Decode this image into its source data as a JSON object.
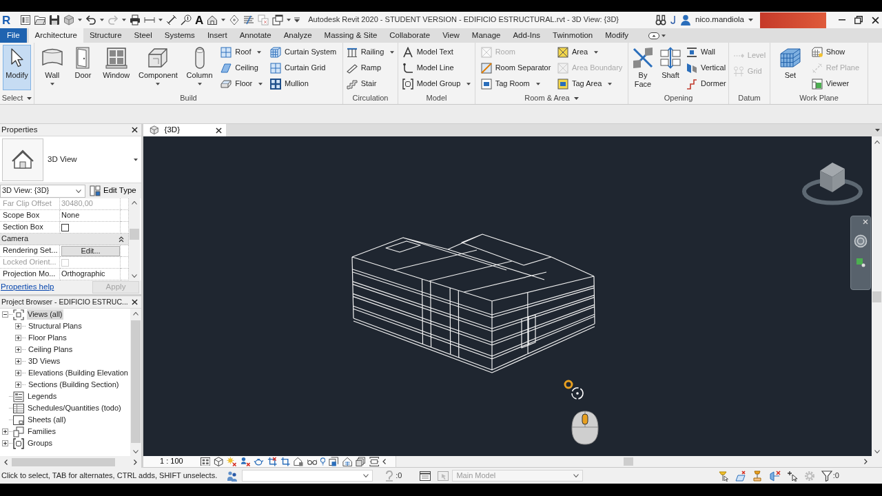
{
  "window": {
    "logo": "R",
    "title": "Autodesk Revit 2020 - STUDENT VERSION - EDIFICIO ESTRUCTURAL.rvt - 3D View: {3D}",
    "user": "nico.mandiola"
  },
  "quick_access": {
    "text_tool": "A"
  },
  "ribbon": {
    "tabs": [
      {
        "kind": "file",
        "label": "File",
        "selected": false
      },
      {
        "kind": "tab",
        "label": "Architecture",
        "selected": true
      },
      {
        "kind": "tab",
        "label": "Structure",
        "selected": false
      },
      {
        "kind": "tab",
        "label": "Steel",
        "selected": false
      },
      {
        "kind": "tab",
        "label": "Systems",
        "selected": false
      },
      {
        "kind": "tab",
        "label": "Insert",
        "selected": false
      },
      {
        "kind": "tab",
        "label": "Annotate",
        "selected": false
      },
      {
        "kind": "tab",
        "label": "Analyze",
        "selected": false
      },
      {
        "kind": "tab",
        "label": "Massing & Site",
        "selected": false
      },
      {
        "kind": "tab",
        "label": "Collaborate",
        "selected": false
      },
      {
        "kind": "tab",
        "label": "View",
        "selected": false
      },
      {
        "kind": "tab",
        "label": "Manage",
        "selected": false
      },
      {
        "kind": "tab",
        "label": "Add-Ins",
        "selected": false
      },
      {
        "kind": "tab",
        "label": "Twinmotion",
        "selected": false
      },
      {
        "kind": "tab",
        "label": "Modify",
        "selected": false
      }
    ],
    "panels": [
      {
        "title": "Select",
        "menu": true,
        "columns": [
          {
            "kind": "large",
            "tools": [
              {
                "label": "Modify",
                "menu": false,
                "active": true,
                "disabled": false
              }
            ]
          }
        ]
      },
      {
        "title": "Build",
        "menu": false,
        "columns": [
          {
            "kind": "large",
            "tools": [
              {
                "label": "Wall",
                "menu": true,
                "active": false,
                "disabled": false
              },
              {
                "label": "Door",
                "menu": false,
                "active": false,
                "disabled": false
              },
              {
                "label": "Window",
                "menu": false,
                "active": false,
                "disabled": false
              },
              {
                "label": "Component",
                "menu": true,
                "active": false,
                "disabled": false
              },
              {
                "label": "Column",
                "menu": true,
                "active": false,
                "disabled": false
              }
            ]
          },
          {
            "kind": "small",
            "tools": [
              {
                "label": "Roof",
                "menu": true,
                "active": false,
                "disabled": false
              },
              {
                "label": "Ceiling",
                "menu": false,
                "active": false,
                "disabled": false
              },
              {
                "label": "Floor",
                "menu": true,
                "active": false,
                "disabled": false
              }
            ]
          },
          {
            "kind": "small",
            "tools": [
              {
                "label": "Curtain System",
                "menu": false,
                "active": false,
                "disabled": false
              },
              {
                "label": "Curtain Grid",
                "menu": false,
                "active": false,
                "disabled": false
              },
              {
                "label": "Mullion",
                "menu": false,
                "active": false,
                "disabled": false
              }
            ]
          }
        ]
      },
      {
        "title": "Circulation",
        "menu": false,
        "columns": [
          {
            "kind": "small",
            "tools": [
              {
                "label": "Railing",
                "menu": true,
                "active": false,
                "disabled": false
              },
              {
                "label": "Ramp",
                "menu": false,
                "active": false,
                "disabled": false
              },
              {
                "label": "Stair",
                "menu": false,
                "active": false,
                "disabled": false
              }
            ]
          }
        ]
      },
      {
        "title": "Model",
        "menu": false,
        "columns": [
          {
            "kind": "small",
            "tools": [
              {
                "label": "Model Text",
                "menu": false,
                "active": false,
                "disabled": false
              },
              {
                "label": "Model Line",
                "menu": false,
                "active": false,
                "disabled": false
              },
              {
                "label": "Model Group",
                "menu": true,
                "active": false,
                "disabled": false
              }
            ]
          }
        ]
      },
      {
        "title": "Room & Area",
        "menu": true,
        "columns": [
          {
            "kind": "small",
            "tools": [
              {
                "label": "Room",
                "menu": false,
                "active": false,
                "disabled": true
              },
              {
                "label": "Room Separator",
                "menu": false,
                "active": false,
                "disabled": false
              },
              {
                "label": "Tag Room",
                "menu": true,
                "active": false,
                "disabled": false
              }
            ]
          },
          {
            "kind": "small",
            "tools": [
              {
                "label": "Area",
                "menu": true,
                "active": false,
                "disabled": false
              },
              {
                "label": "Area Boundary",
                "menu": false,
                "active": false,
                "disabled": true
              },
              {
                "label": "Tag Area",
                "menu": true,
                "active": false,
                "disabled": false
              }
            ]
          }
        ]
      },
      {
        "title": "Opening",
        "menu": false,
        "columns": [
          {
            "kind": "large",
            "tools": [
              {
                "label": "By Face",
                "menu": false,
                "active": false,
                "disabled": false
              },
              {
                "label": "Shaft",
                "menu": false,
                "active": false,
                "disabled": false
              }
            ]
          },
          {
            "kind": "small",
            "tools": [
              {
                "label": "Wall",
                "menu": false,
                "active": false,
                "disabled": false
              },
              {
                "label": "Vertical",
                "menu": false,
                "active": false,
                "disabled": false
              },
              {
                "label": "Dormer",
                "menu": false,
                "active": false,
                "disabled": false
              }
            ]
          }
        ]
      },
      {
        "title": "Datum",
        "menu": false,
        "columns": [
          {
            "kind": "small",
            "tools": [
              {
                "label": "Level",
                "menu": false,
                "active": false,
                "disabled": true
              },
              {
                "label": "Grid",
                "menu": false,
                "active": false,
                "disabled": true
              }
            ]
          }
        ]
      },
      {
        "title": "Work Plane",
        "menu": false,
        "columns": [
          {
            "kind": "large",
            "tools": [
              {
                "label": "Set",
                "menu": false,
                "active": false,
                "disabled": false
              }
            ]
          },
          {
            "kind": "small",
            "tools": [
              {
                "label": "Show",
                "menu": false,
                "active": false,
                "disabled": false
              },
              {
                "label": "Ref Plane",
                "menu": false,
                "active": false,
                "disabled": true
              },
              {
                "label": "Viewer",
                "menu": false,
                "active": false,
                "disabled": false
              }
            ]
          }
        ]
      }
    ]
  },
  "properties": {
    "title": "Properties",
    "type_name": "3D View",
    "view_selector": "3D View: {3D}",
    "edit_type": "Edit Type",
    "rows": [
      {
        "kind": "value",
        "name": "Far Clip Offset",
        "value": "30480,00",
        "disabled": true
      },
      {
        "kind": "value",
        "name": "Scope Box",
        "value": "None",
        "disabled": false
      },
      {
        "kind": "checkbox",
        "name": "Section Box",
        "checked": false,
        "disabled": false
      },
      {
        "kind": "group",
        "name": "Camera",
        "expanded": true
      },
      {
        "kind": "button",
        "name": "Rendering Set...",
        "value": "Edit...",
        "disabled": false
      },
      {
        "kind": "checkbox",
        "name": "Locked Orient...",
        "checked": false,
        "disabled": true
      },
      {
        "kind": "value",
        "name": "Projection Mo...",
        "value": "Orthographic",
        "disabled": false
      }
    ],
    "help_link": "Properties help",
    "apply": {
      "label": "Apply",
      "disabled": true
    }
  },
  "project_browser": {
    "title": "Project Browser - EDIFICIO ESTRUC...",
    "tree": [
      {
        "label": "Views (all)",
        "expanded": true,
        "selected": true,
        "children": [
          {
            "label": "Structural Plans",
            "expanded": false,
            "selected": false
          },
          {
            "label": "Floor Plans",
            "expanded": false,
            "selected": false
          },
          {
            "label": "Ceiling Plans",
            "expanded": false,
            "selected": false
          },
          {
            "label": "3D Views",
            "expanded": false,
            "selected": false
          },
          {
            "label": "Elevations (Building Elevation",
            "expanded": false,
            "selected": false
          },
          {
            "label": "Sections (Building Section)",
            "expanded": false,
            "selected": false
          }
        ]
      },
      {
        "label": "Legends",
        "selected": false
      },
      {
        "label": "Schedules/Quantities (todo)",
        "selected": false
      },
      {
        "label": "Sheets (all)",
        "selected": false
      },
      {
        "label": "Families",
        "expanded": false,
        "selected": false
      },
      {
        "label": "Groups",
        "expanded": false,
        "selected": false
      }
    ]
  },
  "view_tabs": [
    {
      "label": "{3D}",
      "selected": true
    }
  ],
  "view_control_bar": {
    "scale": "1 : 100"
  },
  "status_bar": {
    "message": "Click to select, TAB for alternates, CTRL adds, SHIFT unselects.",
    "option_count": ":0",
    "design_option": {
      "value": "Main Model",
      "disabled": true
    },
    "filter_count": ":0"
  }
}
